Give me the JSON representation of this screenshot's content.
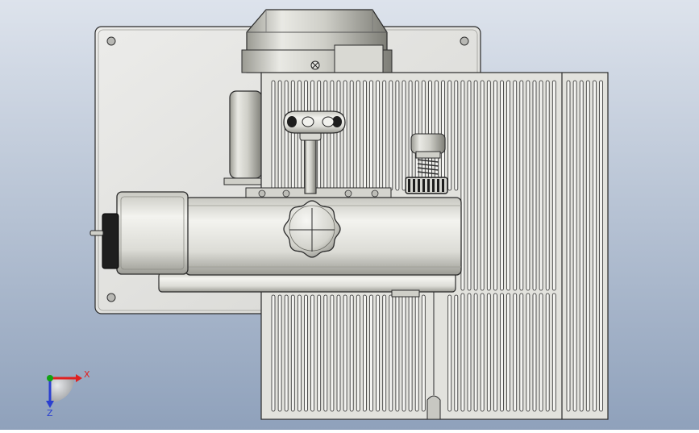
{
  "viewport": {
    "background_top": "#dde3ec",
    "background_bottom": "#8fa1bb"
  },
  "colors": {
    "metal_light": "#eeeeea",
    "metal_mid": "#cfcfc8",
    "metal_dark": "#8d8d86",
    "outline": "#2b2b2b",
    "black_part": "#1e1e1e",
    "axis_x": "#e02020",
    "axis_y": "#12a312",
    "axis_z": "#2a3fd0"
  },
  "triad": {
    "x_label": "X",
    "z_label": "Z"
  },
  "parts": {
    "back_plate": "mounting-plate",
    "motor": "motor-housing",
    "capacitor": "capacitor",
    "table": "slotted-work-table",
    "fence": "fence-guide",
    "gearbox": "gearbox-housing",
    "handwheel": "handwheel-knob",
    "handle": "star-handle",
    "spring": "spring-adjuster",
    "end_cap": "end-cap"
  }
}
